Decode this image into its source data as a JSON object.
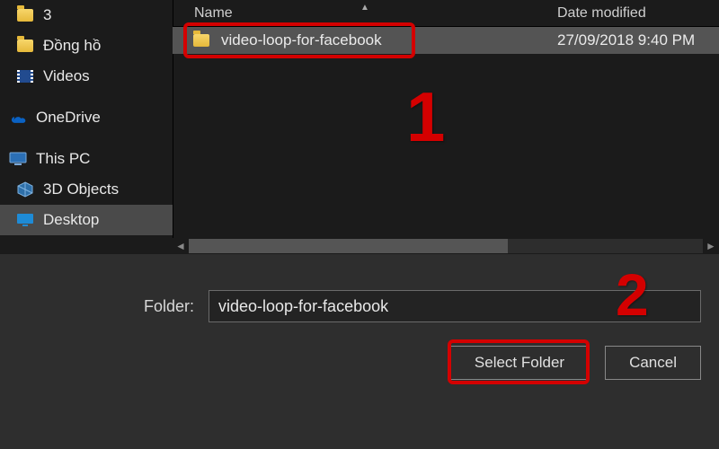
{
  "sidebar": {
    "items": [
      {
        "label": "3",
        "icon": "folder-icon"
      },
      {
        "label": "Đồng hồ",
        "icon": "folder-icon"
      },
      {
        "label": "Videos",
        "icon": "video-icon"
      },
      {
        "label": "OneDrive",
        "icon": "onedrive-icon"
      },
      {
        "label": "This PC",
        "icon": "pc-icon"
      },
      {
        "label": "3D Objects",
        "icon": "3d-icon"
      },
      {
        "label": "Desktop",
        "icon": "desktop-icon",
        "selected": true
      }
    ]
  },
  "columns": {
    "name": "Name",
    "date": "Date modified"
  },
  "files": [
    {
      "name": "video-loop-for-facebook",
      "date": "27/09/2018 9:40 PM"
    }
  ],
  "form": {
    "folder_label": "Folder:",
    "folder_value": "video-loop-for-facebook",
    "select_label": "Select Folder",
    "cancel_label": "Cancel"
  },
  "annotations": {
    "n1": "1",
    "n2": "2"
  },
  "colors": {
    "accent_red": "#d40000"
  }
}
